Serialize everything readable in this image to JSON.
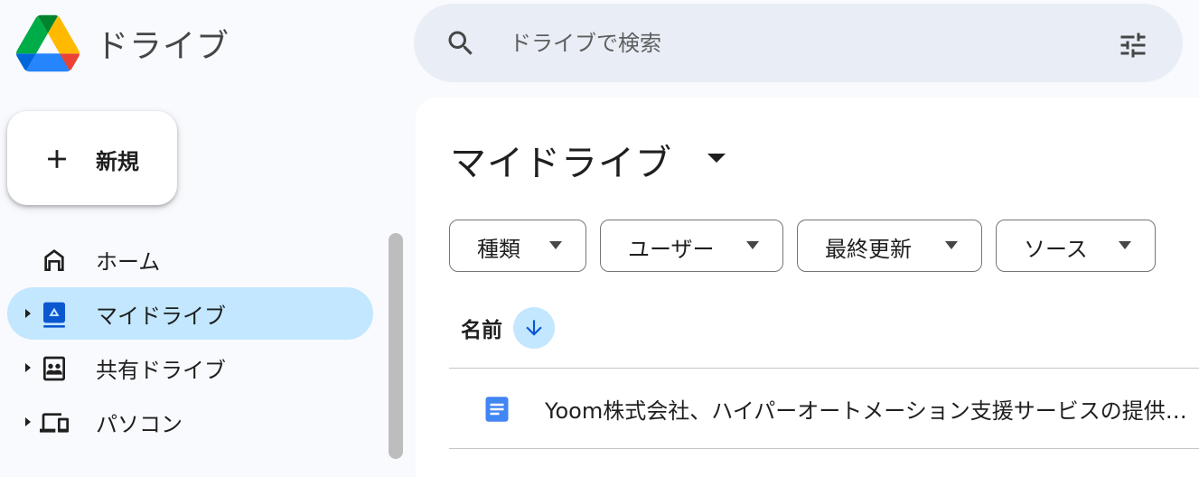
{
  "app": {
    "title": "ドライブ"
  },
  "search": {
    "placeholder": "ドライブで検索"
  },
  "new_button": {
    "label": "新規"
  },
  "sidebar": {
    "items": [
      {
        "label": "ホーム",
        "icon": "home-icon",
        "active": false,
        "expandable": false
      },
      {
        "label": "マイドライブ",
        "icon": "my-drive-icon",
        "active": true,
        "expandable": true
      },
      {
        "label": "共有ドライブ",
        "icon": "shared-drives-icon",
        "active": false,
        "expandable": true
      },
      {
        "label": "パソコン",
        "icon": "computers-icon",
        "active": false,
        "expandable": true
      }
    ]
  },
  "main": {
    "title": "マイドライブ",
    "filters": [
      {
        "label": "種類"
      },
      {
        "label": "ユーザー"
      },
      {
        "label": "最終更新"
      },
      {
        "label": "ソース"
      }
    ],
    "columns": {
      "name": "名前",
      "sort": "descending"
    },
    "files": [
      {
        "name": "Yoom株式会社、ハイパーオートメーション支援サービスの提供を開始",
        "type": "google-docs"
      }
    ]
  },
  "colors": {
    "accent": "#c2e7ff",
    "background": "#f8fafd",
    "search_bg": "#e9eef6",
    "doc_blue": "#4285f4"
  }
}
